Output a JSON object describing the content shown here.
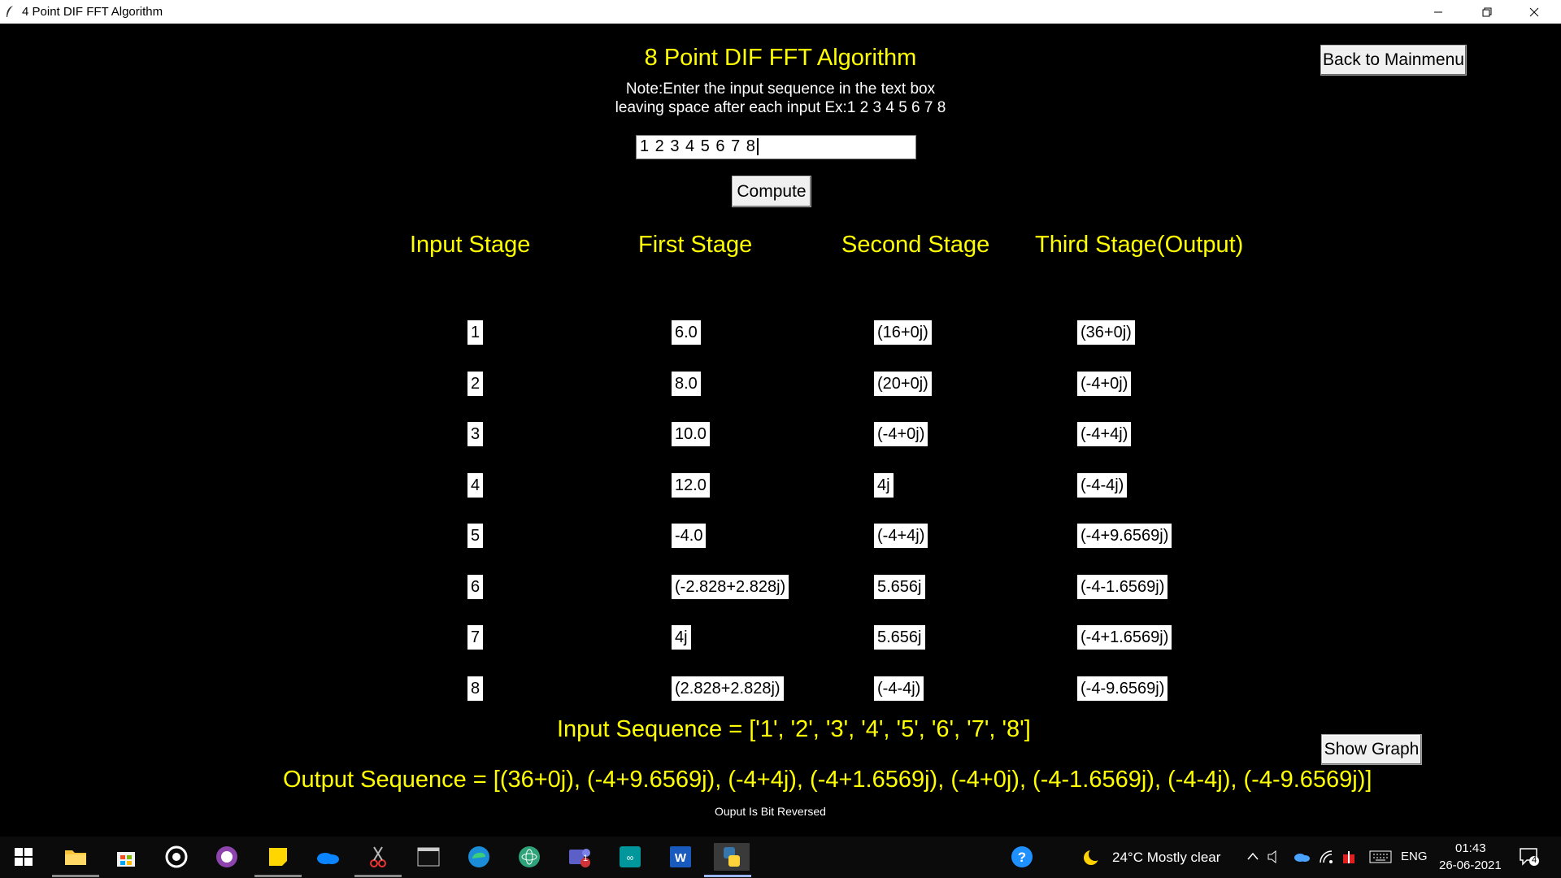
{
  "window": {
    "title": "4 Point DIF FFT Algorithm"
  },
  "header": {
    "title": "8 Point DIF FFT Algorithm",
    "note_line1": "Note:Enter the input sequence in the text box",
    "note_line2": "leaving space after each input Ex:1 2 3 4 5 6 7 8"
  },
  "back_button": "Back to Mainmenu",
  "input": {
    "value": "1 2 3 4 5 6 7 8"
  },
  "compute_button": "Compute",
  "columns": [
    "Input Stage",
    "First Stage",
    "Second Stage",
    "Third Stage(Output)"
  ],
  "rows": [
    {
      "input": "1",
      "first": "6.0",
      "second": "(16+0j)",
      "third": "(36+0j)"
    },
    {
      "input": "2",
      "first": "8.0",
      "second": "(20+0j)",
      "third": "(-4+0j)"
    },
    {
      "input": "3",
      "first": "10.0",
      "second": "(-4+0j)",
      "third": "(-4+4j)"
    },
    {
      "input": "4",
      "first": "12.0",
      "second": "4j",
      "third": "(-4-4j)"
    },
    {
      "input": "5",
      "first": "-4.0",
      "second": "(-4+4j)",
      "third": "(-4+9.6569j)"
    },
    {
      "input": "6",
      "first": "(-2.828+2.828j)",
      "second": "5.656j",
      "third": "(-4-1.6569j)"
    },
    {
      "input": "7",
      "first": "4j",
      "second": "5.656j",
      "third": "(-4+1.6569j)"
    },
    {
      "input": "8",
      "first": "(2.828+2.828j)",
      "second": "(-4-4j)",
      "third": "(-4-9.6569j)"
    }
  ],
  "input_sequence": "Input Sequence = ['1', '2', '3', '4', '5', '6', '7', '8']",
  "output_sequence": "Output Sequence = [(36+0j), (-4+9.6569j), (-4+4j), (-4+1.6569j), (-4+0j), (-4-1.6569j), (-4-4j), (-4-9.6569j)]",
  "show_graph_button": "Show Graph",
  "bit_reversed_note": "Ouput Is Bit Reversed",
  "taskbar": {
    "weather": "24°C  Mostly clear",
    "language": "ENG",
    "time": "01:43",
    "date": "26-06-2021",
    "notification_count": "4",
    "teams_badge": "1"
  }
}
